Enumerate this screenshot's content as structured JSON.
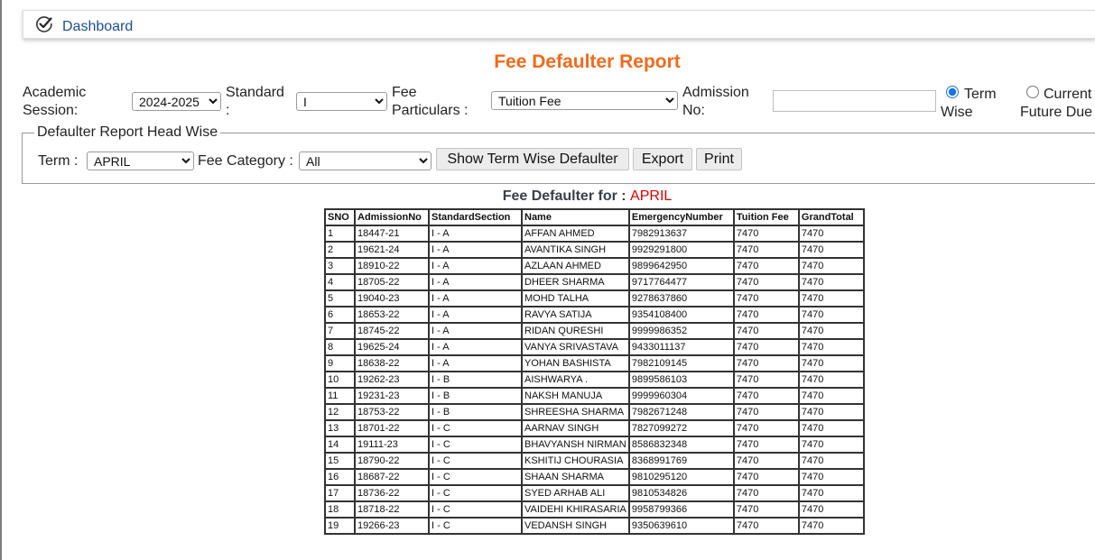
{
  "breadcrumb": {
    "icon": "check-circle-icon",
    "label": "Dashboard"
  },
  "page_title": "Fee Defaulter Report",
  "filters": {
    "academic_session": {
      "label_line1": "Academic",
      "label_line2": "Session:",
      "value": "2024-2025"
    },
    "standard": {
      "label_line1": "Standard",
      "label_line2": ":",
      "value": "I"
    },
    "fee_particulars": {
      "label_line1": "Fee",
      "label_line2": "Particulars :",
      "value": "Tuition Fee"
    },
    "admission_no": {
      "label_line1": "Admission",
      "label_line2": "No:",
      "value": ""
    },
    "radio_term_wise": {
      "label_line1": "Term",
      "label_line2": "Wise",
      "checked": true
    },
    "radio_current_future": {
      "label_line1": "Current",
      "label_line2": "Future Due",
      "checked": false
    }
  },
  "head_wise": {
    "legend": "Defaulter Report Head Wise",
    "term_label": "Term :",
    "term_value": "APRIL",
    "fee_category_label": "Fee Category :",
    "fee_category_value": "All",
    "show_button": "Show Term Wise Defaulter",
    "export_button": "Export",
    "print_button": "Print"
  },
  "report": {
    "heading_prefix": "Fee Defaulter for : ",
    "heading_term": "APRIL",
    "columns": [
      "SNO",
      "AdmissionNo",
      "StandardSection",
      "Name",
      "EmergencyNumber",
      "Tuition Fee",
      "GrandTotal"
    ],
    "rows": [
      [
        "1",
        "18447-21",
        "I - A",
        "AFFAN AHMED",
        "7982913637",
        "7470",
        "7470"
      ],
      [
        "2",
        "19621-24",
        "I - A",
        "AVANTIKA SINGH",
        "9929291800",
        "7470",
        "7470"
      ],
      [
        "3",
        "18910-22",
        "I - A",
        "AZLAAN AHMED",
        "9899642950",
        "7470",
        "7470"
      ],
      [
        "4",
        "18705-22",
        "I - A",
        "DHEER SHARMA",
        "9717764477",
        "7470",
        "7470"
      ],
      [
        "5",
        "19040-23",
        "I - A",
        "MOHD TALHA",
        "9278637860",
        "7470",
        "7470"
      ],
      [
        "6",
        "18653-22",
        "I - A",
        "RAVYA SATIJA",
        "9354108400",
        "7470",
        "7470"
      ],
      [
        "7",
        "18745-22",
        "I - A",
        "RIDAN QURESHI",
        "9999986352",
        "7470",
        "7470"
      ],
      [
        "8",
        "19625-24",
        "I - A",
        "VANYA SRIVASTAVA",
        "9433011137",
        "7470",
        "7470"
      ],
      [
        "9",
        "18638-22",
        "I - A",
        "YOHAN BASHISTA",
        "7982109145",
        "7470",
        "7470"
      ],
      [
        "10",
        "19262-23",
        "I - B",
        "AISHWARYA .",
        "9899586103",
        "7470",
        "7470"
      ],
      [
        "11",
        "19231-23",
        "I - B",
        "NAKSH MANUJA",
        "9999960304",
        "7470",
        "7470"
      ],
      [
        "12",
        "18753-22",
        "I - B",
        "SHREESHA SHARMA",
        "7982671248",
        "7470",
        "7470"
      ],
      [
        "13",
        "18701-22",
        "I - C",
        "AARNAV SINGH",
        "7827099272",
        "7470",
        "7470"
      ],
      [
        "14",
        "19111-23",
        "I - C",
        "BHAVYANSH NIRMAN",
        "8586832348",
        "7470",
        "7470"
      ],
      [
        "15",
        "18790-22",
        "I - C",
        "KSHITIJ CHOURASIA",
        "8368991769",
        "7470",
        "7470"
      ],
      [
        "16",
        "18687-22",
        "I - C",
        "SHAAN SHARMA",
        "9810295120",
        "7470",
        "7470"
      ],
      [
        "17",
        "18736-22",
        "I - C",
        "SYED ARHAB ALI",
        "9810534826",
        "7470",
        "7470"
      ],
      [
        "18",
        "18718-22",
        "I - C",
        "VAIDEHI KHIRASARIA",
        "9958799366",
        "7470",
        "7470"
      ],
      [
        "19",
        "19266-23",
        "I - C",
        "VEDANSH SINGH",
        "9350639610",
        "7470",
        "7470"
      ]
    ]
  },
  "colors": {
    "title": "#f26a1b",
    "term_highlight": "#e00000",
    "link": "#1d4f91"
  }
}
